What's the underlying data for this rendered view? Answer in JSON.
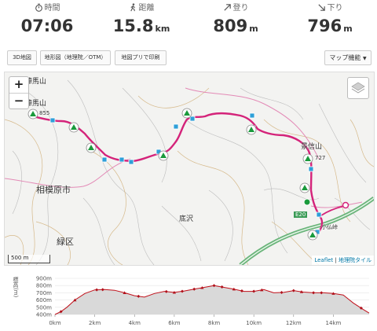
{
  "stats": [
    {
      "label": "時間",
      "value": "07:06",
      "unit": "",
      "icon": "stopwatch-icon"
    },
    {
      "label": "距離",
      "value": "15.8",
      "unit": "km",
      "icon": "hiker-icon"
    },
    {
      "label": "登り",
      "value": "809",
      "unit": "m",
      "icon": "arrow-up-right-icon"
    },
    {
      "label": "下り",
      "value": "796",
      "unit": "m",
      "icon": "arrow-down-right-icon"
    }
  ],
  "toolbar": {
    "btn_3d": "3D地図",
    "btn_topo": "地形図（地理院／OTM）",
    "btn_print": "地図プリで印刷",
    "btn_menu": "マップ機能"
  },
  "map": {
    "labels": {
      "jinba1": "陣馬山",
      "jinba2": "陣馬山",
      "sagamihara": "相模原市",
      "midori": "緑区",
      "sokozawa": "底沢",
      "kagenobu": "景信山",
      "kobotoke": "小仏峠",
      "e20": "E20",
      "num1": "855",
      "num2": "727"
    },
    "scale": "500 m",
    "attrib_leaflet": "Leaflet",
    "attrib_sep": " | ",
    "attrib_tiles": "地理院タイル",
    "colors": {
      "route": "#d4237a",
      "checkpoint": "#2e9fd8",
      "summit": "#1a9a3c",
      "highway": "#6ab47a"
    }
  },
  "chart_data": {
    "type": "area",
    "ylabel": "標高(m)",
    "yticks": [
      "900m",
      "800m",
      "700m",
      "600m",
      "500m",
      "400m"
    ],
    "ylim": [
      400,
      900
    ],
    "xticks": [
      "0km",
      "2km",
      "4km",
      "6km",
      "8km",
      "10km",
      "12km",
      "14km"
    ],
    "xlim": [
      0,
      15.8
    ],
    "x": [
      0,
      0.3,
      0.6,
      1,
      1.5,
      2,
      2.5,
      3,
      3.5,
      4,
      4.5,
      5,
      5.5,
      6,
      6.5,
      7,
      7.5,
      8,
      8.5,
      9,
      9.5,
      10,
      10.5,
      11,
      11.5,
      12,
      12.5,
      13,
      13.5,
      14,
      14.5,
      15,
      15.5,
      15.8
    ],
    "y": [
      400,
      440,
      500,
      600,
      690,
      740,
      745,
      735,
      700,
      660,
      640,
      690,
      720,
      705,
      725,
      750,
      775,
      800,
      775,
      750,
      720,
      720,
      745,
      700,
      705,
      730,
      710,
      700,
      700,
      690,
      670,
      560,
      470,
      420
    ],
    "markers_x": [
      0.3,
      1.0,
      2.1,
      2.4,
      3.5,
      4.2,
      5.6,
      6.0,
      6.4,
      7.0,
      7.4,
      8.0,
      8.4,
      9.0,
      9.4,
      10.0,
      10.4,
      11.4,
      12.0,
      12.4,
      13.0,
      13.4,
      14.0,
      15.4
    ],
    "colors": {
      "line": "#c0101a",
      "fill": "#d9d9d9",
      "marker": "#b0101a"
    }
  }
}
